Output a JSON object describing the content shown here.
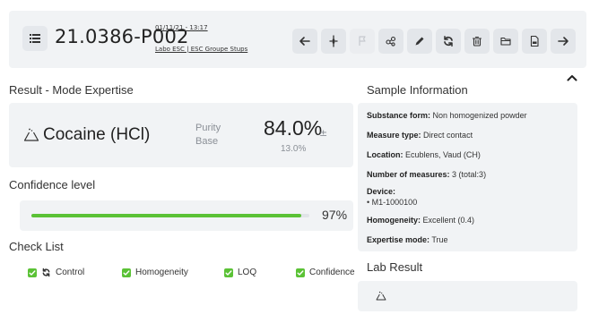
{
  "header": {
    "title": "21.0386-P002",
    "date": "01/11/21 - 13:17",
    "lab": "Labo ESC | ESC Groupe Stups",
    "tools": [
      {
        "name": "back-arrow-icon",
        "enabled": true
      },
      {
        "name": "compare-icon",
        "enabled": true
      },
      {
        "name": "flag-icon",
        "enabled": false
      },
      {
        "name": "molecule-icon",
        "enabled": true
      },
      {
        "name": "edit-pencil-icon",
        "enabled": true
      },
      {
        "name": "refresh-icon",
        "enabled": true
      },
      {
        "name": "trash-icon",
        "enabled": true
      },
      {
        "name": "folder-icon",
        "enabled": true
      },
      {
        "name": "pdf-icon",
        "enabled": true
      },
      {
        "name": "forward-arrow-icon",
        "enabled": true
      }
    ]
  },
  "result": {
    "section_title": "Result - Mode Expertise",
    "substance": "Cocaine (HCl)",
    "purity_label_1": "Purity",
    "purity_label_2": "Base",
    "purity_value": "84.0%",
    "purity_pm": "±",
    "purity_error": "13.0%"
  },
  "confidence": {
    "section_title": "Confidence level",
    "value_text": "97%",
    "value": 0.97
  },
  "checklist": {
    "section_title": "Check List",
    "items": [
      {
        "label": "Control",
        "checked": true,
        "has_refresh_icon": true
      },
      {
        "label": "Homogeneity",
        "checked": true
      },
      {
        "label": "LOQ",
        "checked": true
      },
      {
        "label": "Confidence",
        "checked": true
      }
    ]
  },
  "sample": {
    "section_title": "Sample Information",
    "substance_form_label": "Substance form:",
    "substance_form_value": "Non homogenized powder",
    "measure_type_label": "Measure type:",
    "measure_type_value": "Direct contact",
    "location_label": "Location:",
    "location_value": "Ecublens, Vaud (CH)",
    "num_measures_label": "Number of measures:",
    "num_measures_value": "3 (total:3)",
    "device_label": "Device:",
    "device_value": "M1-1000100",
    "homogeneity_label": "Homogeneity:",
    "homogeneity_value": "Excellent (0.4)",
    "expertise_mode_label": "Expertise mode:",
    "expertise_mode_value": "True"
  },
  "lab_result": {
    "section_title": "Lab Result"
  },
  "colors": {
    "accent_green": "#5bc236",
    "card_bg": "#f1f3f5",
    "tool_bg": "#e3e6ea"
  }
}
